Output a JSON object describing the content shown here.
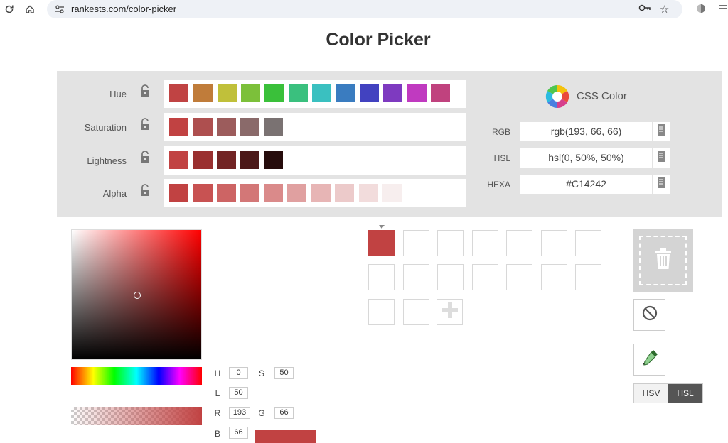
{
  "browser": {
    "url": "rankests.com/color-picker"
  },
  "page": {
    "title": "Color Picker"
  },
  "rows": {
    "hue": {
      "label": "Hue",
      "swatches": [
        "#c04343",
        "#c07c3a",
        "#c0c03a",
        "#7cc03a",
        "#3ac03a",
        "#3ac07e",
        "#3ac0c0",
        "#3a7cc0",
        "#4242c0",
        "#7e3ac0",
        "#c03ac0",
        "#c0427e"
      ]
    },
    "saturation": {
      "label": "Saturation",
      "swatches": [
        "#c14242",
        "#ae4f4f",
        "#9c5c5c",
        "#8a6a6a",
        "#7a7272"
      ]
    },
    "lightness": {
      "label": "Lightness",
      "swatches": [
        "#c14242",
        "#9a2f2f",
        "#722424",
        "#4c1818",
        "#260c0c"
      ]
    },
    "alpha": {
      "label": "Alpha",
      "swatches": [
        "#c14242",
        "#c85252",
        "#cd6464",
        "#d37777",
        "#da8a8a",
        "#e0a0a0",
        "#e7b5b5",
        "#eccaca",
        "#f2dcdc",
        "#f7eeee"
      ]
    }
  },
  "css_color": {
    "title": "CSS Color",
    "formats": [
      {
        "label": "RGB",
        "value": "rgb(193, 66, 66)"
      },
      {
        "label": "HSL",
        "value": "hsl(0, 50%, 50%)"
      },
      {
        "label": "HEXA",
        "value": "#C14242"
      }
    ]
  },
  "values": {
    "h_label": "H",
    "h": "0",
    "s_label": "S",
    "s": "50",
    "l_label": "L",
    "l": "50",
    "r_label": "R",
    "r": "193",
    "g_label": "G",
    "g": "66",
    "b_label": "B",
    "b": "66"
  },
  "current_color": "#c14242",
  "modes": {
    "hsv": "HSV",
    "hsl": "HSL",
    "selected": "HSL"
  }
}
